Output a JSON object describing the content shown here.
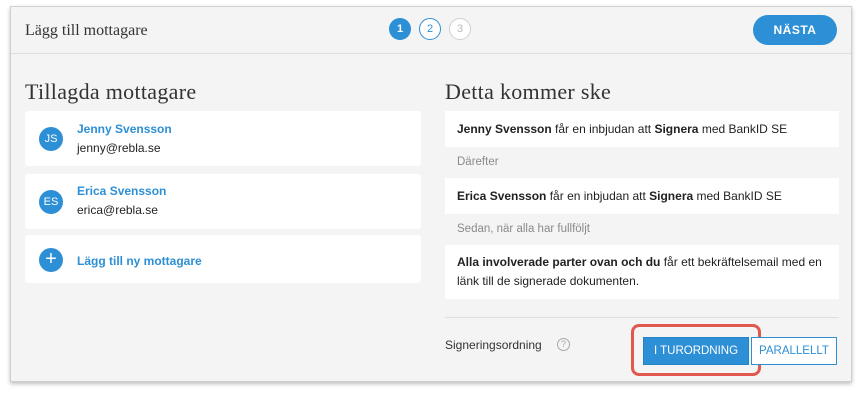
{
  "header": {
    "title": "Lägg till mottagare",
    "steps": [
      "1",
      "2",
      "3"
    ],
    "next_label": "NÄSTA"
  },
  "recipients": {
    "title": "Tillagda mottagare",
    "items": [
      {
        "initials": "JS",
        "name": "Jenny Svensson",
        "email": "jenny@rebla.se"
      },
      {
        "initials": "ES",
        "name": "Erica Svensson",
        "email": "erica@rebla.se"
      }
    ],
    "add_label": "Lägg till ny mottagare",
    "add_icon": "plus-icon"
  },
  "flow": {
    "title": "Detta kommer ske",
    "step1": {
      "name": "Jenny Svensson",
      "text1": " får en inbjudan att ",
      "action": "Signera",
      "text2": " med BankID SE"
    },
    "sep1": "Därefter",
    "step2": {
      "name": "Erica Svensson",
      "text1": " får en inbjudan att ",
      "action": "Signera",
      "text2": " med BankID SE"
    },
    "sep2": "Sedan, när alla har fullföljt",
    "step3": {
      "bold": "Alla involverade parter ovan och du",
      "text": " får ett bekräftelsemail med en länk till de signerade dokumenten."
    }
  },
  "order": {
    "label": "Signeringsordning",
    "help_icon": "question-icon",
    "sequential": "I TURORDNING",
    "parallel": "PARALLELLT",
    "selected": "I TURORDNING"
  },
  "colors": {
    "accent": "#2d8fd5",
    "highlight": "#e0584e"
  }
}
